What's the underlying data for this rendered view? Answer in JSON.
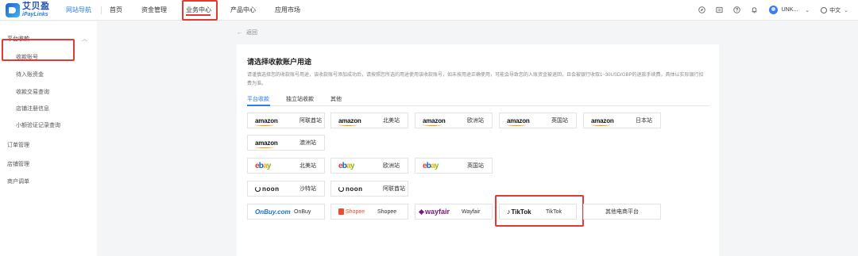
{
  "header": {
    "logo_cn": "艾贝盈",
    "logo_en": "iPayLinks",
    "site_nav": "网站导航",
    "nav": [
      "首页",
      "资金管理",
      "业务中心",
      "产品中心",
      "应用市场"
    ],
    "user_name": "UNK...",
    "language": "中文"
  },
  "sidebar": {
    "group_platform": "平台收款",
    "sub_items": [
      "收款账号",
      "待入账资金",
      "收款交易查询",
      "店铺注册信息",
      "小额验证记录查询"
    ],
    "groups": [
      "订单管理",
      "店铺管理",
      "商户调单"
    ]
  },
  "main": {
    "back": "返回",
    "title": "请选择收款账户用途",
    "description": "请谨慎选择您的收款账号用途，该收款账号添加成功后，请按照您所选的用途使用该收款账号，如未按用途正确使用，可能会导致您的入账资金被退回，且会被银行收取1~30USD/GBP的退款手续费，具体以实际银行扣费为准。",
    "tabs": [
      "平台收款",
      "独立站收款",
      "其他"
    ],
    "options": [
      {
        "brand": "amazon",
        "label": "阿联酋站"
      },
      {
        "brand": "amazon",
        "label": "北美站"
      },
      {
        "brand": "amazon",
        "label": "欧洲站"
      },
      {
        "brand": "amazon",
        "label": "英国站"
      },
      {
        "brand": "amazon",
        "label": "日本站"
      },
      {
        "brand": "amazon",
        "label": "澳洲站"
      },
      {
        "brand": "ebay",
        "label": "北美站"
      },
      {
        "brand": "ebay",
        "label": "欧洲站"
      },
      {
        "brand": "ebay",
        "label": "英国站"
      },
      {
        "brand": "noon",
        "label": "沙特站"
      },
      {
        "brand": "noon",
        "label": "阿联酋站"
      },
      {
        "brand": "OnBuy.com",
        "label": "OnBuy"
      },
      {
        "brand": "Shopee",
        "label": "Shopee"
      },
      {
        "brand": "wayfair",
        "label": "Wayfair"
      },
      {
        "brand": "TikTok",
        "label": "TikTok"
      },
      {
        "brand": "",
        "label": "其他电商平台"
      }
    ]
  }
}
